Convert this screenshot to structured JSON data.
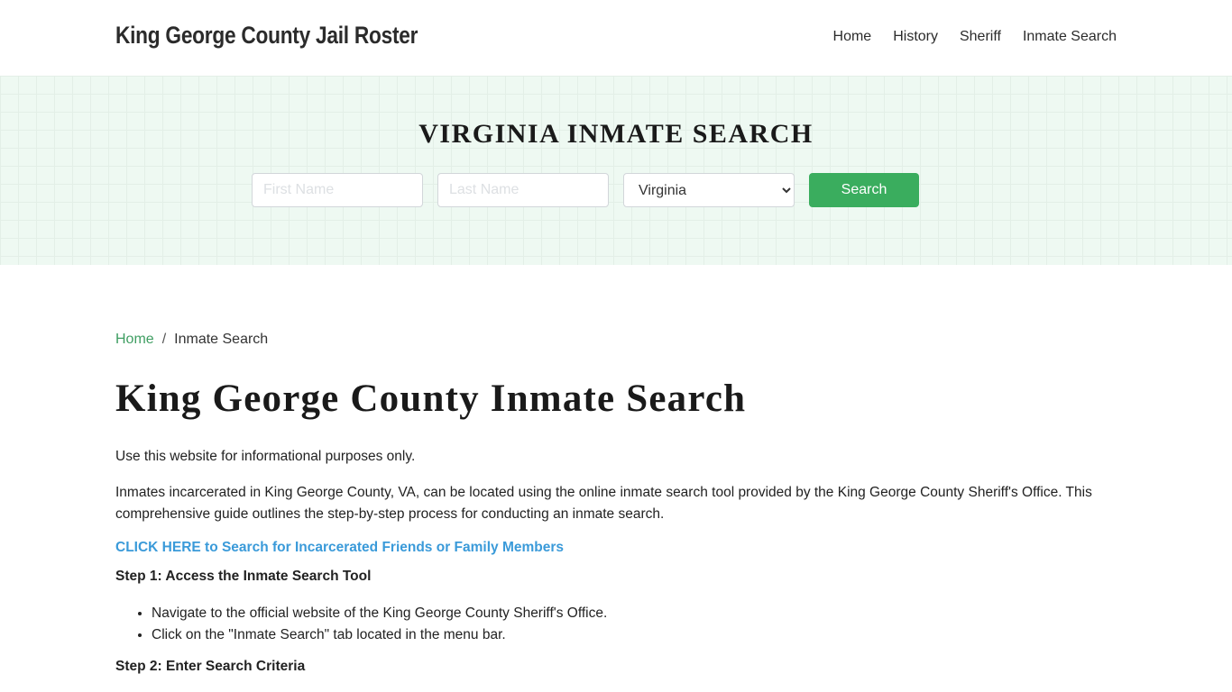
{
  "header": {
    "brand": "King George County Jail Roster",
    "nav": [
      "Home",
      "History",
      "Sheriff",
      "Inmate Search"
    ]
  },
  "hero": {
    "title": "VIRGINIA INMATE SEARCH",
    "first_name_placeholder": "First Name",
    "last_name_placeholder": "Last Name",
    "state_selected": "Virginia",
    "search_label": "Search"
  },
  "breadcrumb": {
    "home": "Home",
    "separator": "/",
    "current": "Inmate Search"
  },
  "main": {
    "title": "King George County Inmate Search",
    "disclaimer": "Use this website for informational purposes only.",
    "intro": "Inmates incarcerated in King George County, VA, can be located using the online inmate search tool provided by the King George County Sheriff's Office. This comprehensive guide outlines the step-by-step process for conducting an inmate search.",
    "cta_link": "CLICK HERE to Search for Incarcerated Friends or Family Members",
    "step1_heading": "Step 1: Access the Inmate Search Tool",
    "step1_items": [
      "Navigate to the official website of the King George County Sheriff's Office.",
      "Click on the \"Inmate Search\" tab located in the menu bar."
    ],
    "step2_heading": "Step 2: Enter Search Criteria"
  },
  "colors": {
    "accent_green": "#3aad5e",
    "link_blue": "#3a9ad9",
    "breadcrumb_green": "#3f9e62",
    "hero_bg": "#eef9f2"
  }
}
